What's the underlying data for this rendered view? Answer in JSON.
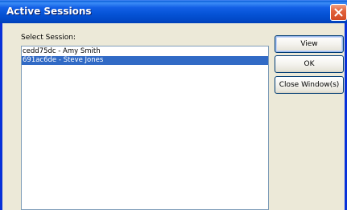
{
  "window": {
    "title": "Active Sessions",
    "close_icon": "close-icon",
    "accent_color": "#0553d6",
    "close_color": "#d24a24"
  },
  "session_list": {
    "label": "Select Session:",
    "items": [
      {
        "label": "cedd75dc - Amy Smith",
        "selected": false
      },
      {
        "label": "691ac6de - Steve Jones",
        "selected": true
      }
    ],
    "selection_color": "#316ac5"
  },
  "buttons": {
    "view_label": "View",
    "ok_label": "OK",
    "close_window_label": "Close Window(s)"
  }
}
